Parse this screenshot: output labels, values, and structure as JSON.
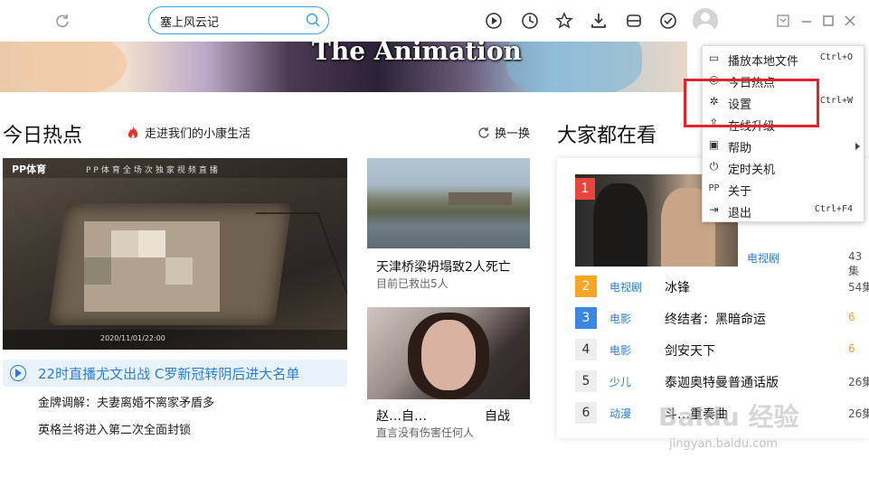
{
  "search": {
    "value": "塞上风云记"
  },
  "banner": {
    "title": "The Animation"
  },
  "hot": {
    "section_title": "今日热点",
    "link": "走进我们的小康生活",
    "refresh": "换一换",
    "big_video": {
      "brand": "PP体育",
      "subtitle": "PP体育全场次独家视频直播",
      "footer": "2020/11/01/22:00"
    },
    "live_headline": "22时直播尤文出战 C罗新冠转阴后进大名单",
    "lines": [
      "金牌调解：夫妻离婚不离家矛盾多",
      "英格兰将进入第二次全面封锁"
    ],
    "cards": [
      {
        "title": "天津桥梁坍塌致2人死亡",
        "sub": "目前已救出5人"
      },
      {
        "title": "赵…自…",
        "sub": "直言没有伤害任何人",
        "title_end": "自战"
      }
    ]
  },
  "trending": {
    "section_title": "大家都在看",
    "featured": {
      "rank": "1",
      "category": "电视剧",
      "count": "43集"
    },
    "rows": [
      {
        "rank": "2",
        "category": "电视剧",
        "title": "冰锋",
        "count": "54集",
        "color": "#f5a623",
        "text_color": "#ffffff"
      },
      {
        "rank": "3",
        "category": "电影",
        "title": "终结者：黑暗命运",
        "count": "6",
        "color": "#3b86e0",
        "text_color": "#ffffff"
      },
      {
        "rank": "4",
        "category": "电影",
        "title": "剑安天下",
        "count": "6",
        "color": "#eeeeee",
        "text_color": "#333333"
      },
      {
        "rank": "5",
        "category": "少儿",
        "title": "泰迦奥特曼普通话版",
        "count": "26集",
        "color": "#eeeeee",
        "text_color": "#333333"
      },
      {
        "rank": "6",
        "category": "动漫",
        "title": "斗…重奏曲",
        "count": "26集",
        "color": "#eeeeee",
        "text_color": "#333333"
      }
    ]
  },
  "menu": {
    "items": [
      {
        "icon": "folder-icon",
        "glyph": "▭",
        "label": "播放本地文件",
        "shortcut": "Ctrl+O"
      },
      {
        "icon": "hot-icon",
        "glyph": "◎",
        "label": "今日热点",
        "shortcut": ""
      },
      {
        "icon": "gear-icon",
        "glyph": "✲",
        "label": "设置",
        "shortcut": "Ctrl+W"
      },
      {
        "icon": "upgrade-icon",
        "glyph": "⇧",
        "label": "在线升级",
        "shortcut": ""
      },
      {
        "icon": "help-icon",
        "glyph": "▣",
        "label": "帮助",
        "shortcut": ""
      },
      {
        "icon": "power-icon",
        "glyph": "⏻",
        "label": "定时关机",
        "shortcut": ""
      },
      {
        "icon": "pp-icon",
        "glyph": "PP",
        "label": "关于",
        "shortcut": ""
      },
      {
        "icon": "exit-icon",
        "glyph": "⇥",
        "label": "退出",
        "shortcut": "Ctrl+F4"
      }
    ]
  },
  "watermark": {
    "main": "Baidu 经验",
    "sub": "jingyan.baidu.com"
  },
  "colors": {
    "accent": "#3aa0e8",
    "link": "#2b7ed6",
    "highlight": "#e3232c",
    "rank1": "#e8463c"
  }
}
